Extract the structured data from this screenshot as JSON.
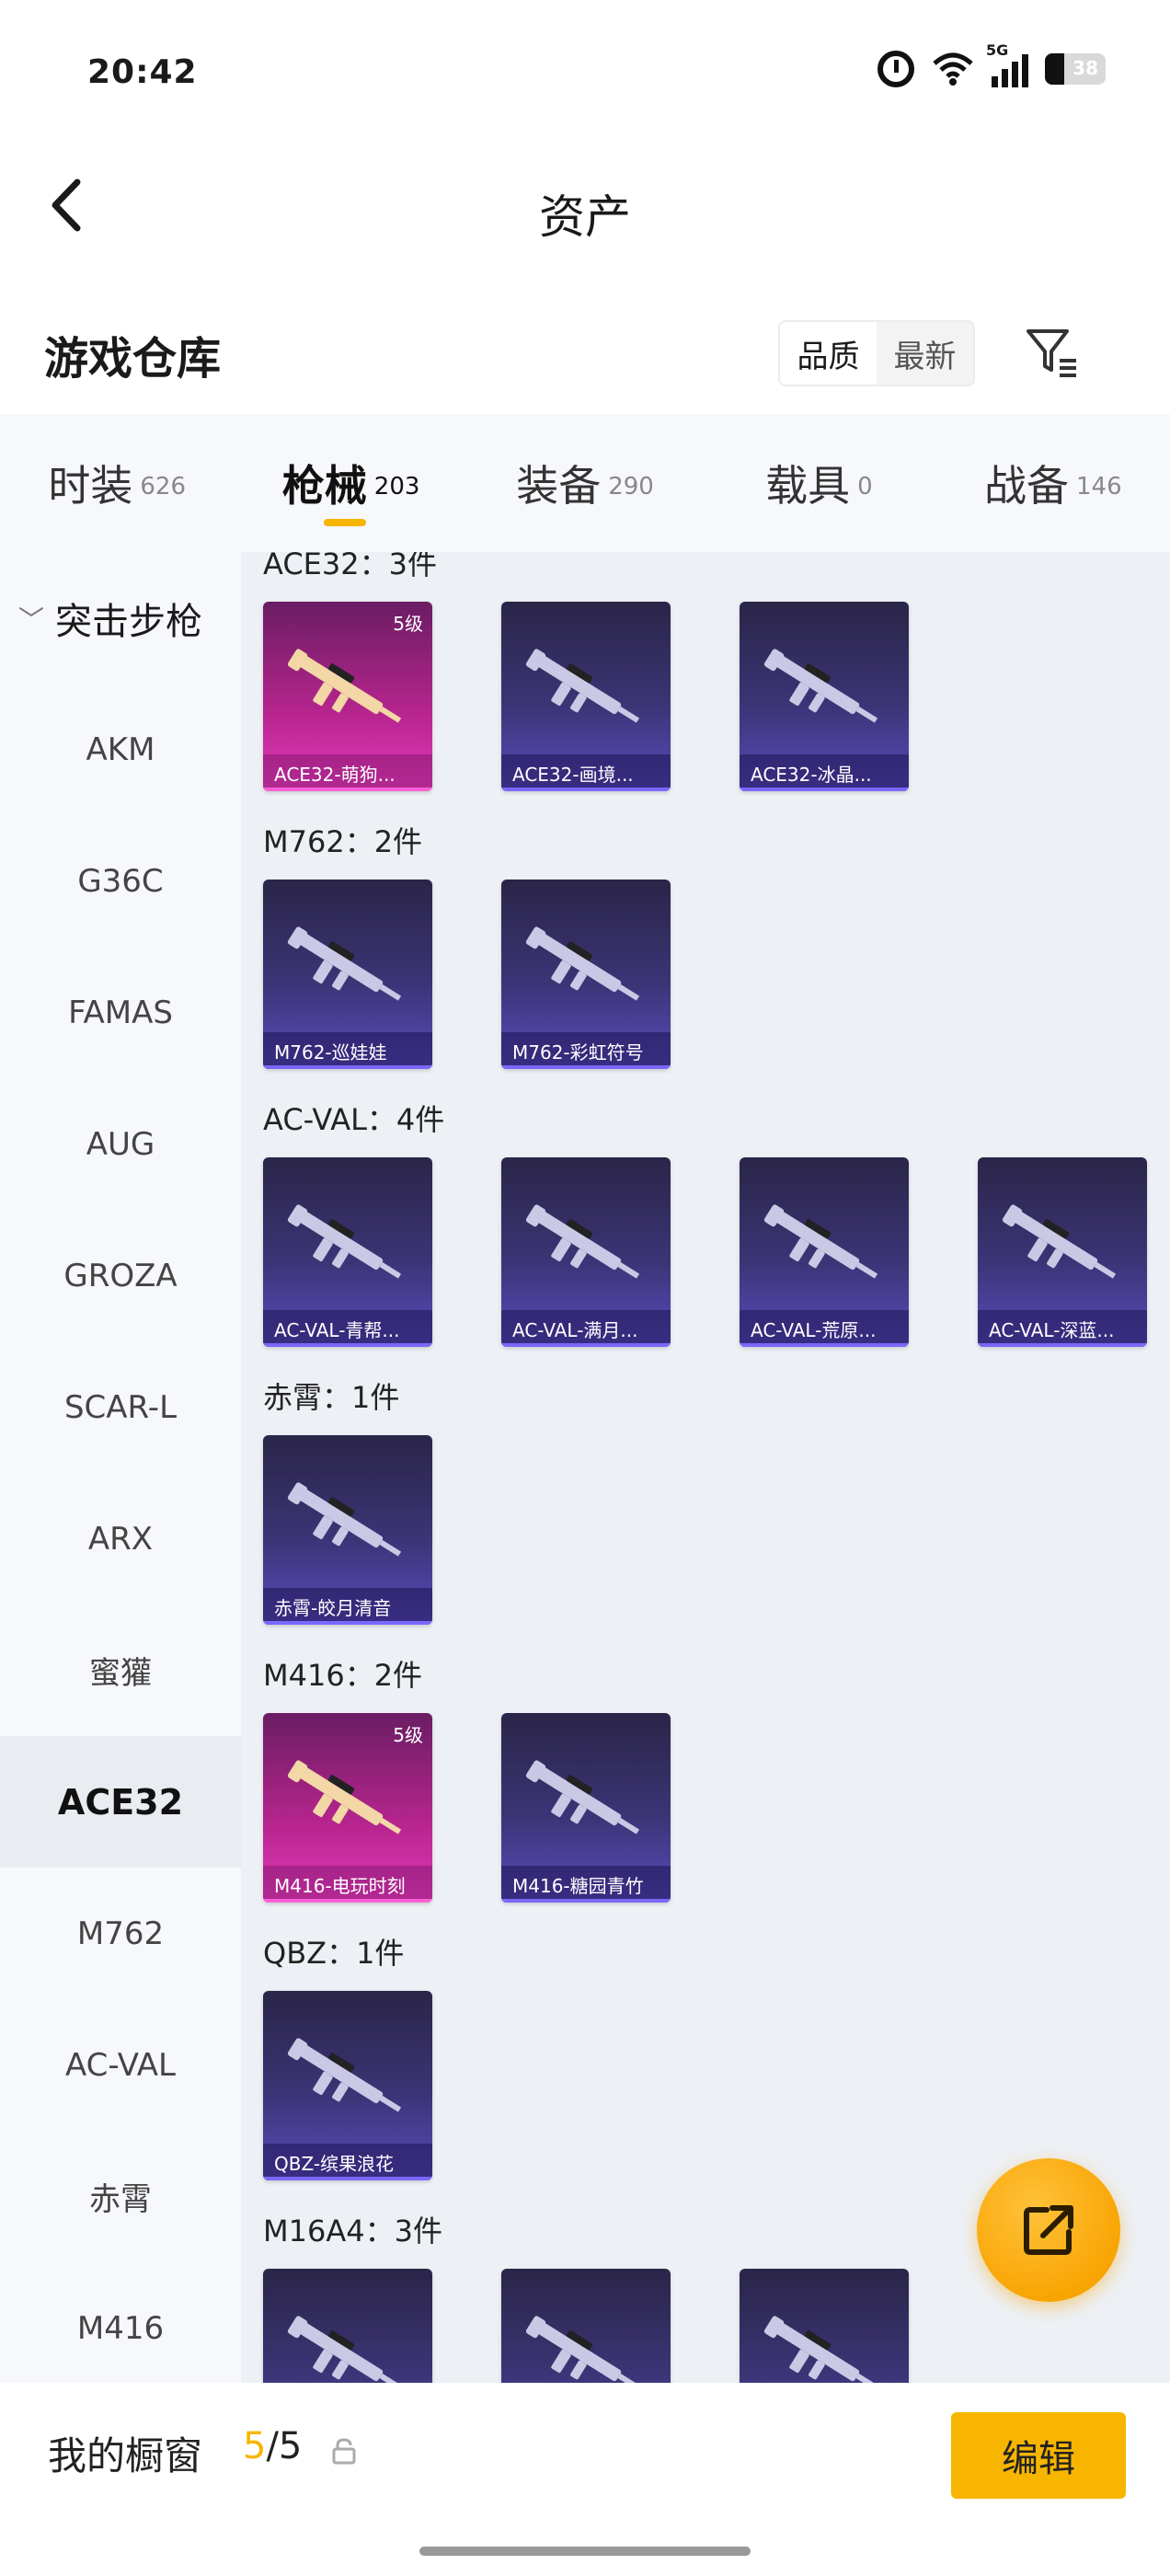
{
  "status_bar": {
    "time": "20:42",
    "network": "5G",
    "battery": "38"
  },
  "header": {
    "title": "资产"
  },
  "warehouse": {
    "title": "游戏仓库",
    "sort_options": [
      "品质",
      "最新"
    ]
  },
  "tabs": [
    {
      "label": "时装",
      "count": "626"
    },
    {
      "label": "枪械",
      "count": "203"
    },
    {
      "label": "装备",
      "count": "290"
    },
    {
      "label": "载具",
      "count": "0"
    },
    {
      "label": "战备",
      "count": "146"
    }
  ],
  "sidebar": {
    "group": "突击步枪",
    "items": [
      "AKM",
      "G36C",
      "FAMAS",
      "AUG",
      "GROZA",
      "SCAR-L",
      "ARX",
      "蜜獾",
      "ACE32",
      "M762",
      "AC-VAL",
      "赤霄",
      "M416"
    ]
  },
  "sections": [
    {
      "title": "ACE32：3件",
      "cards": [
        {
          "label": "ACE32-萌狗...",
          "level": "5级",
          "rarity": "pink"
        },
        {
          "label": "ACE32-画境...",
          "level": "",
          "rarity": "purple"
        },
        {
          "label": "ACE32-冰晶...",
          "level": "",
          "rarity": "purple"
        }
      ]
    },
    {
      "title": "M762：2件",
      "cards": [
        {
          "label": "M762-巡娃娃",
          "level": "",
          "rarity": "purple"
        },
        {
          "label": "M762-彩虹符号",
          "level": "",
          "rarity": "purple"
        }
      ]
    },
    {
      "title": "AC-VAL：4件",
      "cards": [
        {
          "label": "AC-VAL-青帮...",
          "level": "",
          "rarity": "purple"
        },
        {
          "label": "AC-VAL-满月...",
          "level": "",
          "rarity": "purple"
        },
        {
          "label": "AC-VAL-荒原...",
          "level": "",
          "rarity": "purple"
        },
        {
          "label": "AC-VAL-深蓝...",
          "level": "",
          "rarity": "purple"
        }
      ]
    },
    {
      "title": "赤霄：1件",
      "cards": [
        {
          "label": "赤霄-皎月清音",
          "level": "",
          "rarity": "purple"
        }
      ]
    },
    {
      "title": "M416：2件",
      "cards": [
        {
          "label": "M416-电玩时刻",
          "level": "5级",
          "rarity": "pink"
        },
        {
          "label": "M416-糖园青竹",
          "level": "",
          "rarity": "purple"
        }
      ]
    },
    {
      "title": "QBZ：1件",
      "cards": [
        {
          "label": "QBZ-缤果浪花",
          "level": "",
          "rarity": "purple"
        }
      ]
    },
    {
      "title": "M16A4：3件",
      "cards": [
        {
          "label": "",
          "level": "",
          "rarity": "purple"
        },
        {
          "label": "",
          "level": "",
          "rarity": "purple"
        },
        {
          "label": "",
          "level": "",
          "rarity": "purple"
        }
      ]
    }
  ],
  "bottom_bar": {
    "label": "我的橱窗",
    "current": "5",
    "total": "/5",
    "edit": "编辑"
  },
  "colors": {
    "accent": "#f7b500",
    "card_purple": "#3c3476",
    "card_pink": "#b8258f"
  },
  "icons": [
    "alarm-icon",
    "wifi-icon",
    "signal-icon",
    "battery-icon",
    "back-icon",
    "filter-icon",
    "chevron-down-icon",
    "share-icon",
    "lock-icon",
    "rifle-icon"
  ]
}
